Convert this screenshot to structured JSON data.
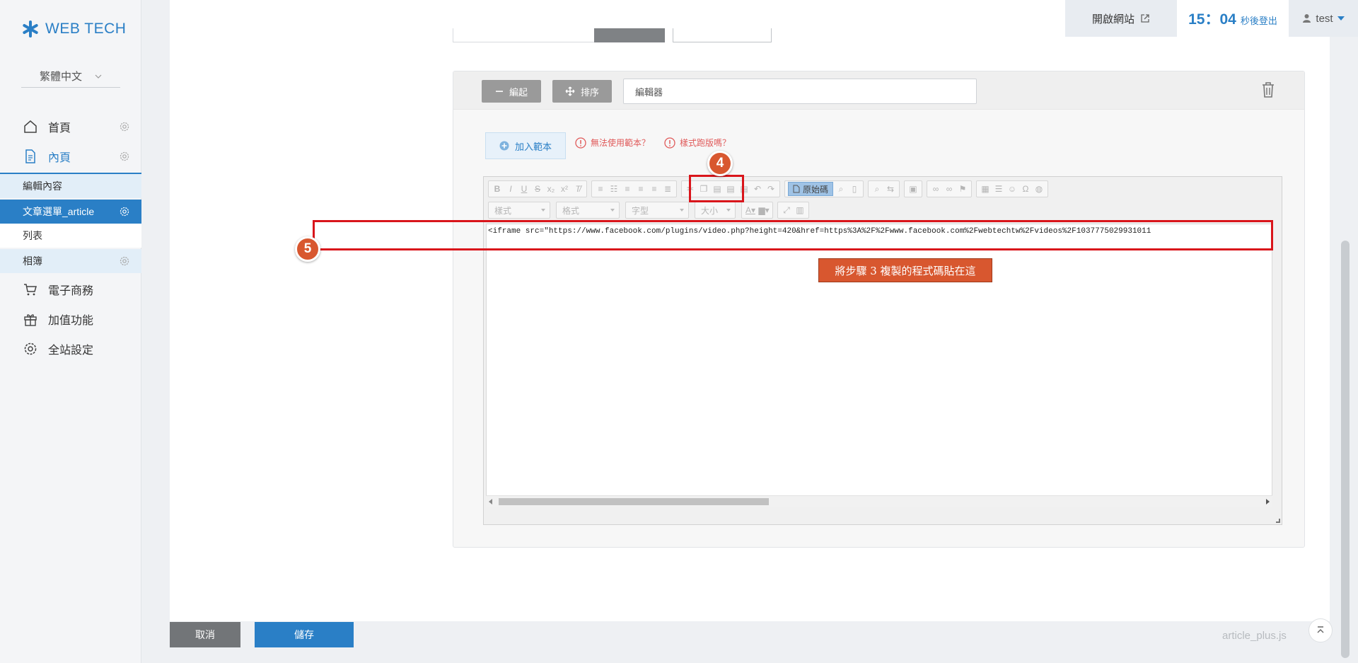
{
  "brand": {
    "name": "WEB TECH"
  },
  "sidebar": {
    "language": "繁體中文",
    "nav": [
      {
        "label": "首頁",
        "icon": "home-icon"
      },
      {
        "label": "內頁",
        "icon": "document-icon"
      },
      {
        "label": "電子商務",
        "icon": "cart-icon"
      },
      {
        "label": "加值功能",
        "icon": "gift-icon"
      },
      {
        "label": "全站設定",
        "icon": "gear-icon"
      }
    ],
    "subitems": [
      {
        "label": "編輯內容"
      },
      {
        "label": "文章選單_article"
      },
      {
        "label": "列表"
      },
      {
        "label": "相簿"
      }
    ]
  },
  "topbar": {
    "open_site": "開啟網站",
    "timer": "15：04",
    "timer_label": "秒後登出",
    "user": "test"
  },
  "block": {
    "collapse_label": "編起",
    "sort_label": "排序",
    "title_value": "編輯器",
    "add_template_label": "加入範本",
    "warn_1": "無法使用範本？",
    "warn_2": "樣式跑版嗎？"
  },
  "editor": {
    "source_label": "原始碼",
    "combos": {
      "styles": "樣式",
      "format": "格式",
      "font": "字型",
      "size": "大小"
    },
    "code": "<iframe src=\"https://www.facebook.com/plugins/video.php?height=420&href=https%3A%2F%2Fwww.facebook.com%2Fwebtechtw%2Fvideos%2F1037775029931011"
  },
  "annotations": {
    "step4": "4",
    "step5": "5",
    "callout": "將步驟 3 複製的程式碼貼在這"
  },
  "footer": {
    "cancel_label": "取消",
    "save_label": "儲存",
    "filename": "article_plus.js"
  },
  "colors": {
    "accent": "#2a7fc6",
    "annotation": "#d9151b",
    "badge": "#d8572f"
  }
}
